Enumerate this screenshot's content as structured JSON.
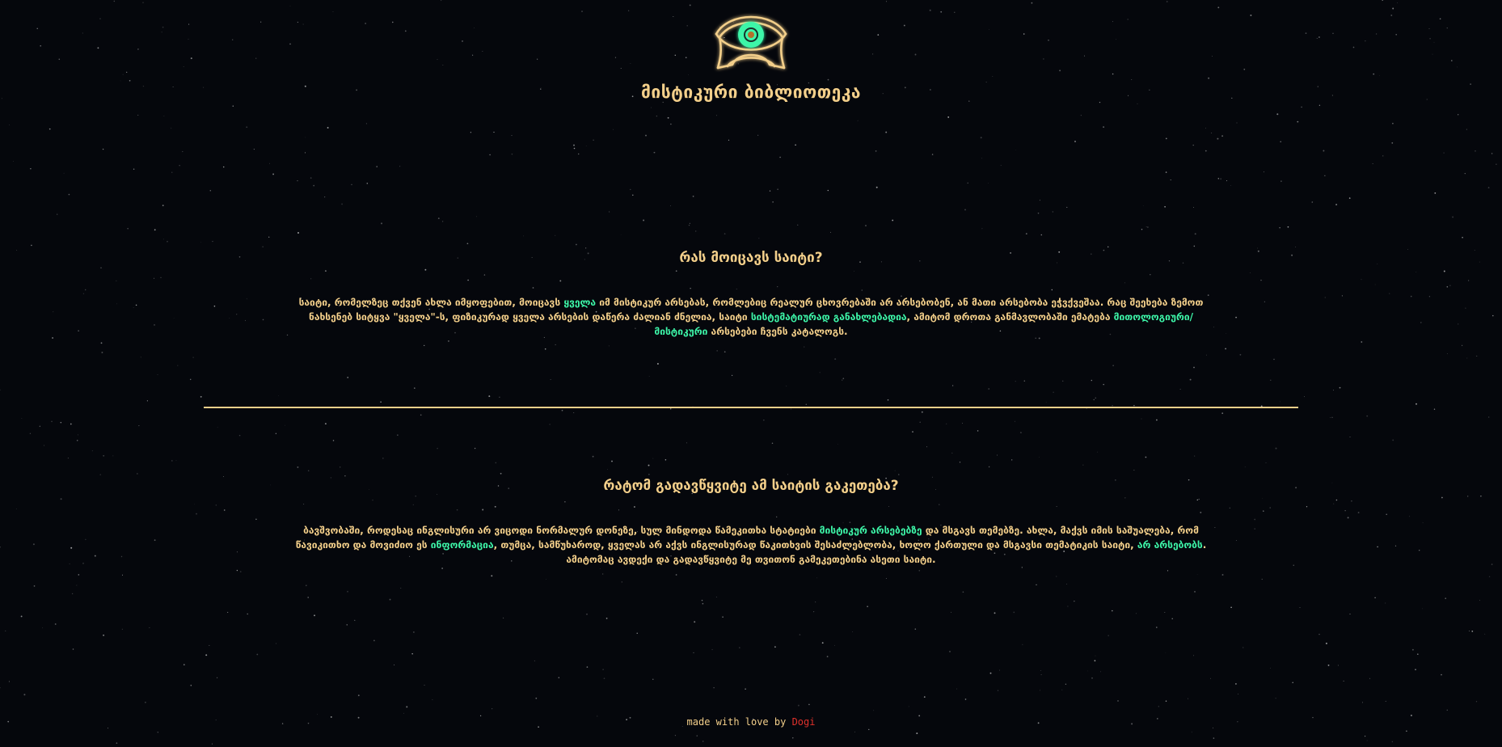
{
  "header": {
    "logo_icon": "eye-icon",
    "title": "მისტიკური ბიბლიოთეკა"
  },
  "section1": {
    "heading": "რას მოიცავს საიტი?",
    "parts": [
      {
        "text": "საიტი, რომელზეც თქვენ ახლა იმყოფებით, მოიცავს ",
        "hl": false
      },
      {
        "text": "ყველა",
        "hl": true
      },
      {
        "text": " იმ მისტიკურ არსებას, რომლებიც რეალურ ცხოვრებაში არ არსებობენ, ან მათი არსებობა ეჭვქვეშაა. რაც შეეხება ზემოთ ნახსენებ სიტყვა \"ყველა\"-ს, ფიზიკურად ყველა არსების დაწერა ძალიან ძნელია, საიტი ",
        "hl": false
      },
      {
        "text": "სისტემატიურად განახლებადია",
        "hl": true
      },
      {
        "text": ", ამიტომ დროთა განმავლობაში ემატება ",
        "hl": false
      },
      {
        "text": "მითოლოგიური/ მისტიკური",
        "hl": true
      },
      {
        "text": " არსებები ჩვენს კატალოგს.",
        "hl": false
      }
    ]
  },
  "section2": {
    "heading": "რატომ გადავწყვიტე ამ საიტის გაკეთება?",
    "parts": [
      {
        "text": "ბავშვობაში, როდესაც ინგლისური არ ვიცოდი ნორმალურ დონეზე, სულ მინდოდა წამეკითხა სტატიები ",
        "hl": false
      },
      {
        "text": "მისტიკურ არსებებზე",
        "hl": true
      },
      {
        "text": " და მსგავს თემებზე. ახლა, მაქვს იმის საშუალება, რომ წავიკითხო და მოვიძიო ეს ",
        "hl": false
      },
      {
        "text": "ინფორმაცია",
        "hl": true
      },
      {
        "text": ", თუმცა, სამწუხაროდ, ყველას არ აქვს ინგლისურად წაკითხვის შესაძლებლობა, ხოლო ქართული და მსგავსი თემატიკის საიტი, ",
        "hl": false
      },
      {
        "text": "არ არსებობს",
        "hl": true
      },
      {
        "text": ". ამიტომაც ავდექი და გადავწყვიტე მე თვითონ გამეკეთებინა ასეთი საიტი.",
        "hl": false
      }
    ]
  },
  "footer": {
    "prefix": "made with love by ",
    "author": "Dogi"
  },
  "colors": {
    "background": "#05070c",
    "gold": "#f3cf8a",
    "highlight": "#3df5a8",
    "author": "#e0312b",
    "eye_iris": "#3df5a8"
  }
}
